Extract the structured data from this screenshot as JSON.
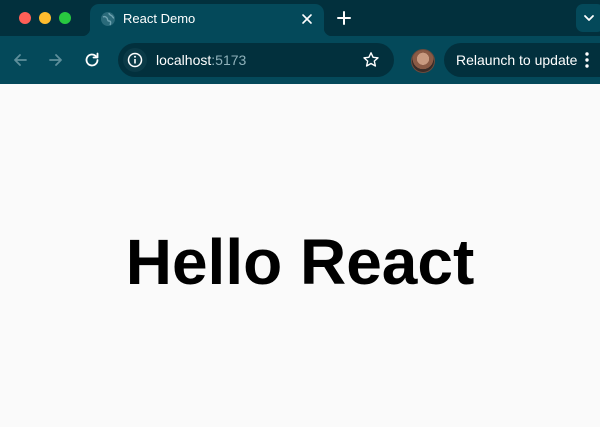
{
  "tab": {
    "title": "React Demo"
  },
  "omnibox": {
    "host": "localhost",
    "port": ":5173"
  },
  "toolbar": {
    "relaunch_label": "Relaunch to update"
  },
  "page": {
    "heading": "Hello React"
  },
  "colors": {
    "tabstrip_bg": "#02303d",
    "toolbar_bg": "#04495a",
    "page_bg": "#fafafa",
    "text_on_dark": "#ffffff",
    "heading_text": "#000000"
  },
  "icons": [
    "globe-icon",
    "close-icon",
    "plus-icon",
    "chevron-down-icon",
    "back-arrow-icon",
    "forward-arrow-icon",
    "reload-icon",
    "info-icon",
    "star-icon",
    "more-vert-icon"
  ]
}
